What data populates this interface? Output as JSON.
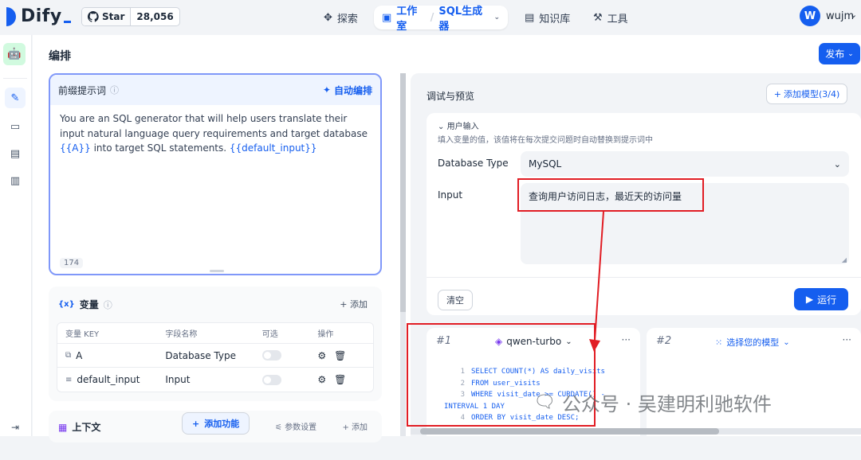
{
  "topbar": {
    "brand": "Dify",
    "github_star_label": "Star",
    "github_star_count": "28,056",
    "nav": [
      {
        "label": "探索",
        "icon": "compass-icon"
      },
      {
        "label": "工作室",
        "icon": "studio-icon",
        "active": true
      },
      {
        "label": "SQL生成器",
        "icon": "chevron-down-icon"
      },
      {
        "label": "知识库",
        "icon": "book-icon"
      },
      {
        "label": "工具",
        "icon": "toolbox-icon"
      }
    ],
    "user_initial": "W",
    "user_name": "wujm"
  },
  "page": {
    "title": "编排",
    "publish_label": "发布"
  },
  "prompt": {
    "heading": "前缀提示词",
    "auto_label": "自动编排",
    "text_part1": "You are an SQL generator that will help users translate their input natural language query requirements and target database ",
    "var_a": "{{A}}",
    "text_part2": " into target SQL statements. ",
    "var_default_input": "{{default_input}}",
    "char_count": "174"
  },
  "variables": {
    "heading": "变量",
    "add_label": "添加",
    "columns": [
      "变量 KEY",
      "字段名称",
      "可选",
      "操作"
    ],
    "rows": [
      {
        "key": "A",
        "name": "Database Type",
        "icon": "select-var-icon"
      },
      {
        "key": "default_input",
        "name": "Input",
        "icon": "text-var-icon"
      }
    ]
  },
  "context": {
    "heading": "上下文",
    "add_feature_label": "添加功能",
    "param_label": "参数设置",
    "add_label": "添加"
  },
  "preview": {
    "title": "调试与预览",
    "add_model_label": "添加模型(3/4)",
    "user_input_label": "用户输入",
    "hint": "填入变量的值，该值将在每次提交问题时自动替换到提示词中",
    "db_type_label": "Database Type",
    "db_type_value": "MySQL",
    "input_label": "Input",
    "input_value": "查询用户访问日志，最近天的访问量",
    "clear_label": "清空",
    "run_label": "运行"
  },
  "models": [
    {
      "index": "#1",
      "name": "qwen-turbo"
    },
    {
      "index": "#2",
      "name": "选择您的模型"
    }
  ],
  "code_lines": [
    {
      "n": "1",
      "text": "SELECT COUNT(*) AS daily_visits"
    },
    {
      "n": "2",
      "text": "FROM user_visits"
    },
    {
      "n": "3",
      "text": "WHERE visit_date >= CURDATE() -"
    },
    {
      "n": "",
      "text": "INTERVAL 1 DAY"
    },
    {
      "n": "4",
      "text": "ORDER BY visit_date DESC;"
    }
  ],
  "watermark": "公众号 · 吴建明利驰软件",
  "colors": {
    "accent": "#155eef",
    "highlight": "#e11d24"
  }
}
